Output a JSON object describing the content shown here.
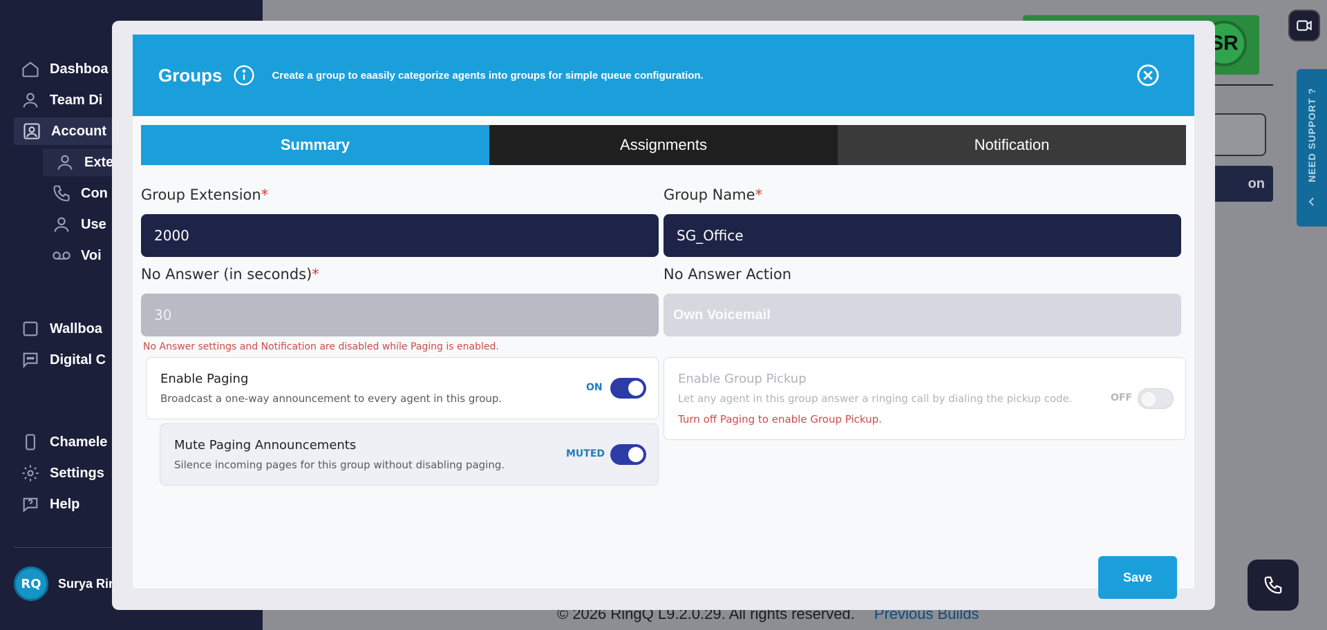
{
  "sidebar": {
    "items": [
      {
        "label": "Dashboa",
        "icon": "home-icon"
      },
      {
        "label": "Team Di",
        "icon": "user-icon"
      },
      {
        "label": "Account",
        "icon": "account-icon"
      },
      {
        "label": "Exte",
        "icon": "user-icon"
      },
      {
        "label": "Con",
        "icon": "phone-icon"
      },
      {
        "label": "Use",
        "icon": "user-icon"
      },
      {
        "label": "Voi",
        "icon": "voicemail-icon"
      },
      {
        "label": "Wallboa",
        "icon": "square-icon"
      },
      {
        "label": "Digital C",
        "icon": "chat-icon"
      },
      {
        "label": "Chamele",
        "icon": "phone-device-icon"
      },
      {
        "label": "Settings",
        "icon": "gear-icon"
      },
      {
        "label": "Help",
        "icon": "help-icon"
      }
    ],
    "user": {
      "initials": "RQ",
      "name": "Surya Rin"
    }
  },
  "background": {
    "logo_initials": "SR",
    "button_fragment": "on",
    "support_label": "NEED SUPPORT ?"
  },
  "footer": {
    "copyright": "© 2026 RingQ L9.2.0.29. All rights reserved.",
    "link": "Previous Builds"
  },
  "modal": {
    "title": "Groups",
    "description": "Create a group to eaasily categorize agents into groups for simple queue configuration.",
    "tabs": [
      {
        "label": "Summary",
        "active": true
      },
      {
        "label": "Assignments",
        "active": false
      },
      {
        "label": "Notification",
        "active": false
      }
    ],
    "fields": {
      "group_extension": {
        "label": "Group Extension",
        "value": "2000",
        "required": true
      },
      "group_name": {
        "label": "Group Name",
        "value": "SG_Office",
        "required": true
      },
      "no_answer": {
        "label": "No Answer (in seconds)",
        "value": "30",
        "required": true
      },
      "no_answer_action": {
        "label": "No Answer Action",
        "value": "Own Voicemail"
      }
    },
    "warning": "No Answer settings and Notification are disabled while Paging is enabled.",
    "paging": {
      "title": "Enable Paging",
      "desc": "Broadcast a one-way announcement to every agent in this group.",
      "state": "ON"
    },
    "mute": {
      "title": "Mute Paging Announcements",
      "desc": "Silence incoming pages for this group without disabling paging.",
      "state": "MUTED"
    },
    "pickup": {
      "title": "Enable Group Pickup",
      "desc": "Let any agent in this group answer a ringing call by dialing the pickup code.",
      "state": "OFF",
      "warning": "Turn off Paging to enable Group Pickup."
    },
    "save_label": "Save"
  },
  "colors": {
    "header": "#1b9fdb",
    "field_dark": "#1e2447",
    "toggle_on": "#2b3ca6",
    "warning": "#cf4b4b"
  }
}
